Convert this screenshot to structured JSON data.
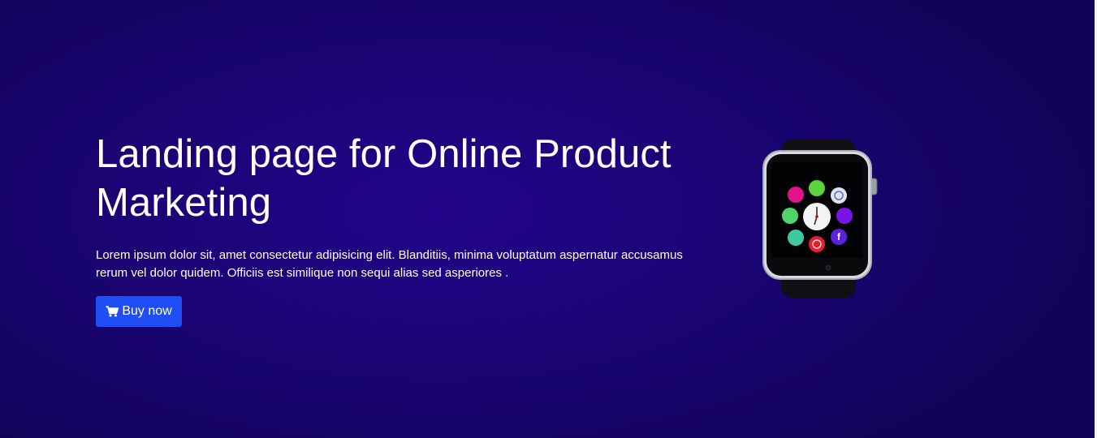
{
  "hero": {
    "title": "Landing page for Online Product Marketing",
    "description": "Lorem ipsum dolor sit, amet consectetur adipisicing elit. Blanditiis, minima voluptatum aspernatur accusamus rerum vel dolor quidem. Officiis est similique non sequi alias sed asperiores .",
    "button_label": "Buy now",
    "button_icon": "shopping-cart-icon",
    "product_image": "smartwatch-image"
  },
  "colors": {
    "background": "#1b0478",
    "button": "#1f4ef5",
    "text": "#ffffff"
  }
}
